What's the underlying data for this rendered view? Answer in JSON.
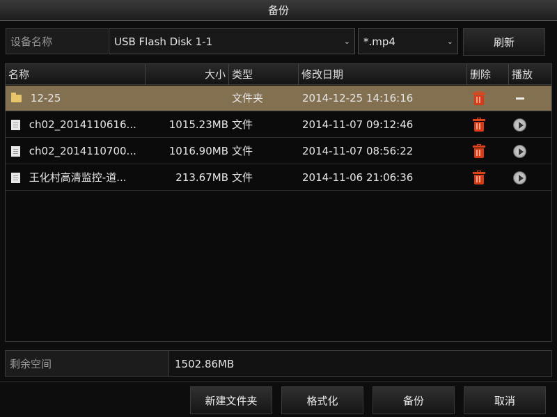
{
  "window": {
    "title": "备份"
  },
  "device": {
    "label": "设备名称",
    "selected": "USB Flash Disk 1-1",
    "filter": "*.mp4",
    "refresh_label": "刷新"
  },
  "table": {
    "columns": {
      "name": "名称",
      "size": "大小",
      "type": "类型",
      "modified": "修改日期",
      "delete": "删除",
      "play": "播放"
    },
    "rows": [
      {
        "icon": "folder-icon",
        "name": "12-25",
        "size": "",
        "type": "文件夹",
        "modified": "2014-12-25 14:16:16",
        "play": "none"
      },
      {
        "icon": "file-icon",
        "name": "ch02_2014110616...",
        "size": "1015.23MB",
        "type": "文件",
        "modified": "2014-11-07 09:12:46",
        "play": "play"
      },
      {
        "icon": "file-icon",
        "name": "ch02_2014110700...",
        "size": "1016.90MB",
        "type": "文件",
        "modified": "2014-11-07 08:56:22",
        "play": "play"
      },
      {
        "icon": "file-icon",
        "name": "王化村高清监控-道...",
        "size": "213.67MB",
        "type": "文件",
        "modified": "2014-11-06 21:06:36",
        "play": "play"
      }
    ]
  },
  "storage": {
    "label": "剩余空间",
    "value": "1502.86MB"
  },
  "buttons": {
    "new_folder": "新建文件夹",
    "format": "格式化",
    "backup": "备份",
    "cancel": "取消"
  }
}
